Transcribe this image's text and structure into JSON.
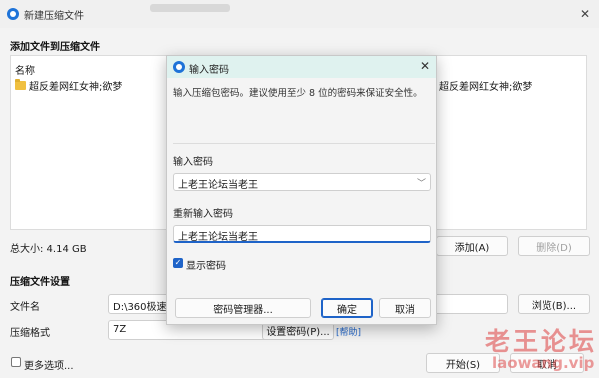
{
  "main": {
    "title": "新建压缩文件",
    "section_add": "添加文件到压缩文件",
    "col_name": "名称",
    "file_item": "超反差网红女神;欲梦",
    "file_item_cont": "超反差网红女神;欲梦",
    "total_size": "总大小: 4.14 GB",
    "add_button": "添加(A)",
    "delete_button": "删除(D)",
    "section_settings": "压缩文件设置",
    "filename_label": "文件名",
    "filename_value": "D:\\360极速浏",
    "browse_button": "浏览(B)...",
    "format_label": "压缩格式",
    "format_value": "7Z",
    "set_password_button": "设置密码(P)...",
    "help_link": "帮助",
    "more_options": "更多选项...",
    "start_button": "开始(S)",
    "cancel_button": "取消"
  },
  "dialog": {
    "title": "输入密码",
    "description": "输入压缩包密码。建议使用至少 8 位的密码来保证安全性。",
    "password_label": "输入密码",
    "password_value": "上老王论坛当老王",
    "confirm_label": "重新输入密码",
    "confirm_value": "上老王论坛当老王",
    "show_password": "显示密码",
    "manager_button": "密码管理器...",
    "ok_button": "确定",
    "cancel_button": "取消"
  },
  "watermark": {
    "title": "老王论坛",
    "url": "laowang.vip"
  },
  "colors": {
    "accent": "#1e63c8",
    "dialog_titlebar": "#dff2ef",
    "watermark": "#e15a5a"
  }
}
